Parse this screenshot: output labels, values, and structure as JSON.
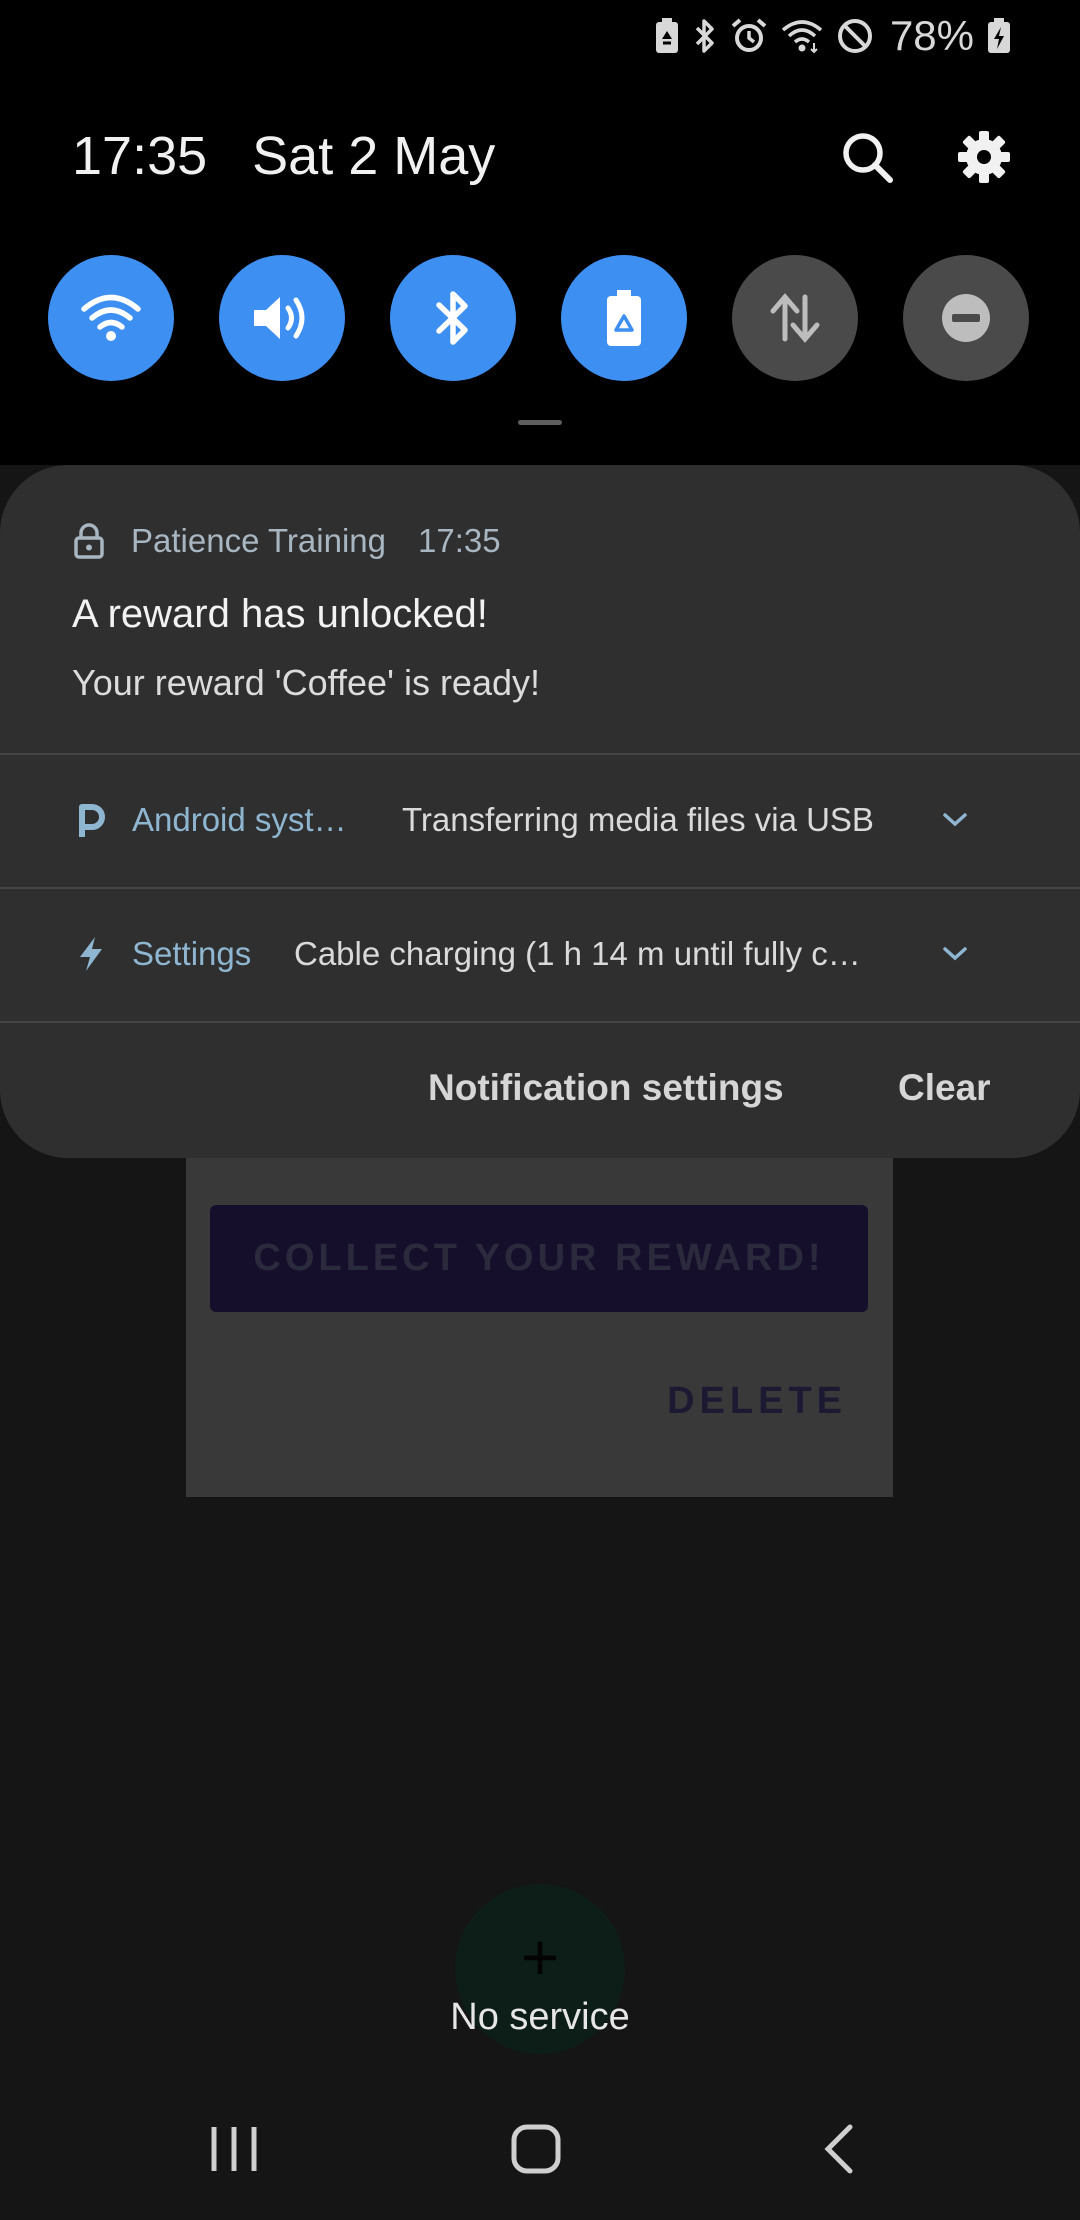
{
  "status_bar": {
    "battery_percent": "78%",
    "icons": [
      "battery-saver-icon",
      "bluetooth-icon",
      "alarm-icon",
      "wifi-icon",
      "do-not-disturb-icon",
      "battery-charging-icon"
    ]
  },
  "header": {
    "time": "17:35",
    "date": "Sat 2 May",
    "icons": [
      "search-icon",
      "settings-gear-icon"
    ]
  },
  "quick_settings": [
    {
      "name": "wifi",
      "icon": "wifi-icon",
      "active": true
    },
    {
      "name": "sound",
      "icon": "volume-icon",
      "active": true
    },
    {
      "name": "bluetooth",
      "icon": "bluetooth-icon",
      "active": true
    },
    {
      "name": "power-saving",
      "icon": "battery-recycle-icon",
      "active": true
    },
    {
      "name": "mobile-data",
      "icon": "data-transfer-icon",
      "active": false
    },
    {
      "name": "do-not-disturb",
      "icon": "minus-circle-icon",
      "active": false
    }
  ],
  "notifications": {
    "main": {
      "app_name": "Patience Training",
      "time": "17:35",
      "title": "A reward has unlocked!",
      "body": "Your reward 'Coffee' is ready!"
    },
    "android_system": {
      "app_name": "Android syst…",
      "text": "Transferring media files via USB"
    },
    "settings": {
      "app_name": "Settings",
      "text": "Cable charging (1 h 14 m until fully c…"
    },
    "actions": {
      "notification_settings": "Notification settings",
      "clear": "Clear"
    }
  },
  "background_app": {
    "collect_button": "COLLECT YOUR REWARD!",
    "delete_button": "DELETE",
    "fab_label": "+",
    "no_service": "No service"
  },
  "colors": {
    "accent": "#3e8ff2",
    "panel": "#2f2f2f",
    "app_label": "#8fb6d1"
  }
}
